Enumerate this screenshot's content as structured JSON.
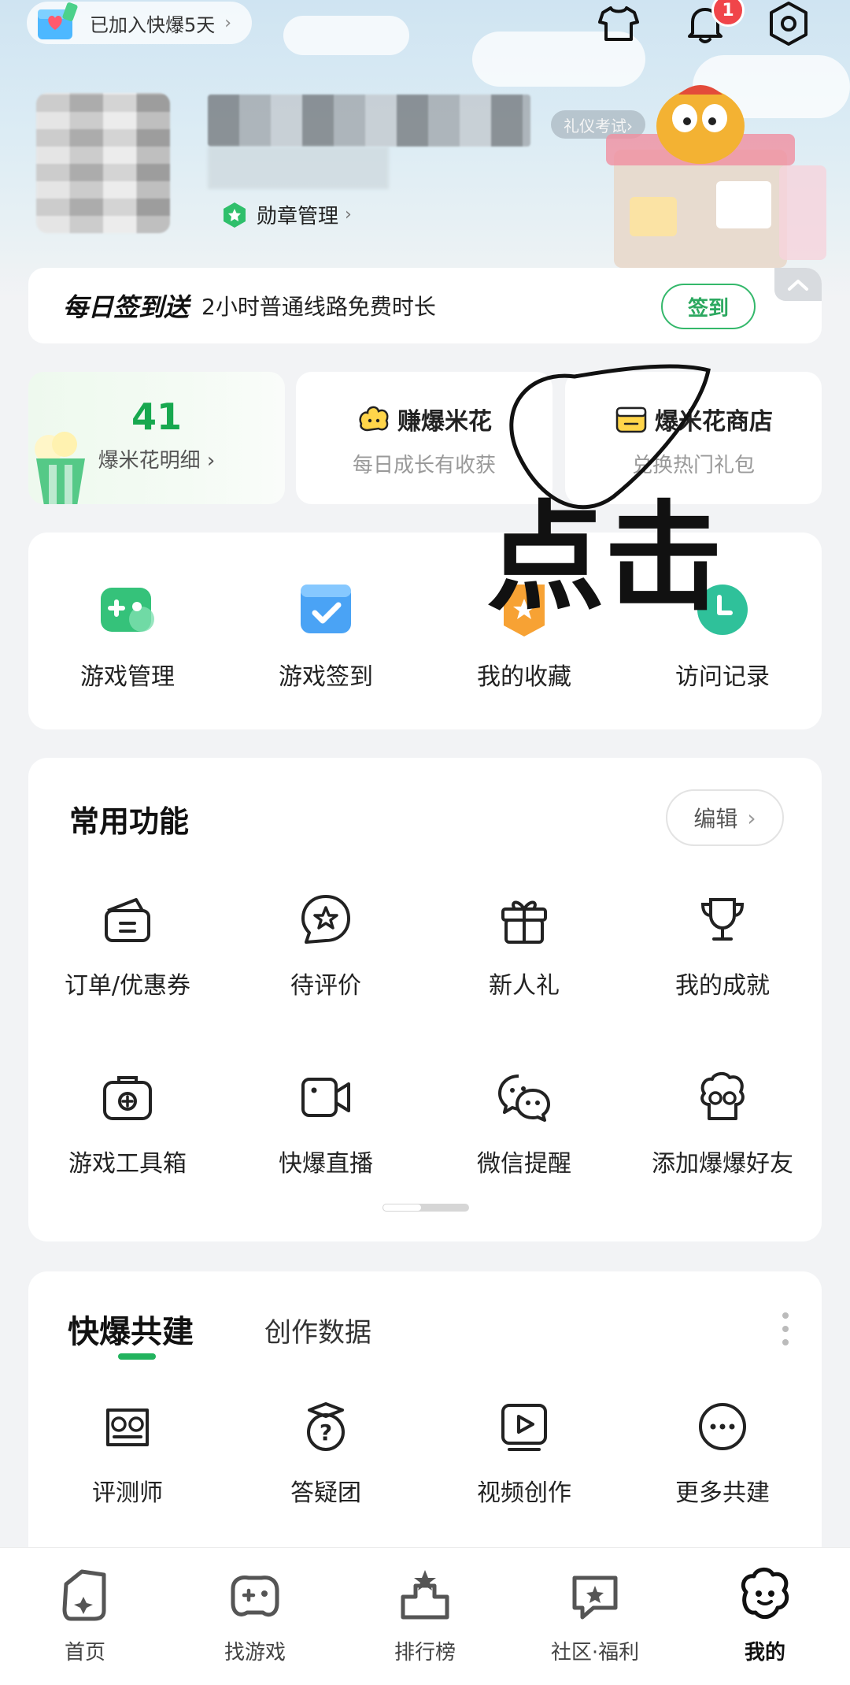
{
  "header": {
    "join_text": "已加入快爆5天",
    "etiquette_label": "礼仪考试›",
    "medal_label": "勋章管理",
    "notification_count": "1"
  },
  "signin": {
    "title": "每日签到送",
    "desc": "2小时普通线路免费时长",
    "button": "签到"
  },
  "cards": [
    {
      "value": "41",
      "label": "爆米花明细"
    },
    {
      "title": "赚爆米花",
      "subtitle": "每日成长有收获"
    },
    {
      "title": "爆米花商店",
      "subtitle": "兑换热门礼包"
    }
  ],
  "handwriting": "点击",
  "quick_items": [
    {
      "label": "游戏管理",
      "icon": "gamepad-icon"
    },
    {
      "label": "游戏签到",
      "icon": "calendar-check-icon"
    },
    {
      "label": "我的收藏",
      "icon": "star-bookmark-icon"
    },
    {
      "label": "访问记录",
      "icon": "clock-icon"
    }
  ],
  "common": {
    "title": "常用功能",
    "edit": "编辑",
    "items": [
      {
        "label": "订单/优惠券",
        "icon": "wallet-icon"
      },
      {
        "label": "待评价",
        "icon": "star-bubble-icon"
      },
      {
        "label": "新人礼",
        "icon": "gift-icon"
      },
      {
        "label": "我的成就",
        "icon": "trophy-icon"
      },
      {
        "label": "游戏工具箱",
        "icon": "toolbox-icon"
      },
      {
        "label": "快爆直播",
        "icon": "video-camera-icon"
      },
      {
        "label": "微信提醒",
        "icon": "wechat-icon"
      },
      {
        "label": "添加爆爆好友",
        "icon": "mascot-icon"
      }
    ]
  },
  "cobuild": {
    "tab_active": "快爆共建",
    "tab_other": "创作数据",
    "items": [
      {
        "label": "评测师",
        "icon": "owl-reviewer-icon"
      },
      {
        "label": "答疑团",
        "icon": "question-hat-icon"
      },
      {
        "label": "视频创作",
        "icon": "play-video-icon"
      },
      {
        "label": "更多共建",
        "icon": "more-icon"
      }
    ]
  },
  "nav": [
    {
      "label": "首页",
      "icon": "home-icon"
    },
    {
      "label": "找游戏",
      "icon": "find-game-icon"
    },
    {
      "label": "排行榜",
      "icon": "ranking-icon"
    },
    {
      "label": "社区·福利",
      "icon": "community-icon"
    },
    {
      "label": "我的",
      "icon": "profile-icon"
    }
  ],
  "colors": {
    "accent": "#22b35e",
    "badge": "#f0454a",
    "background": "#f2f3f5"
  }
}
